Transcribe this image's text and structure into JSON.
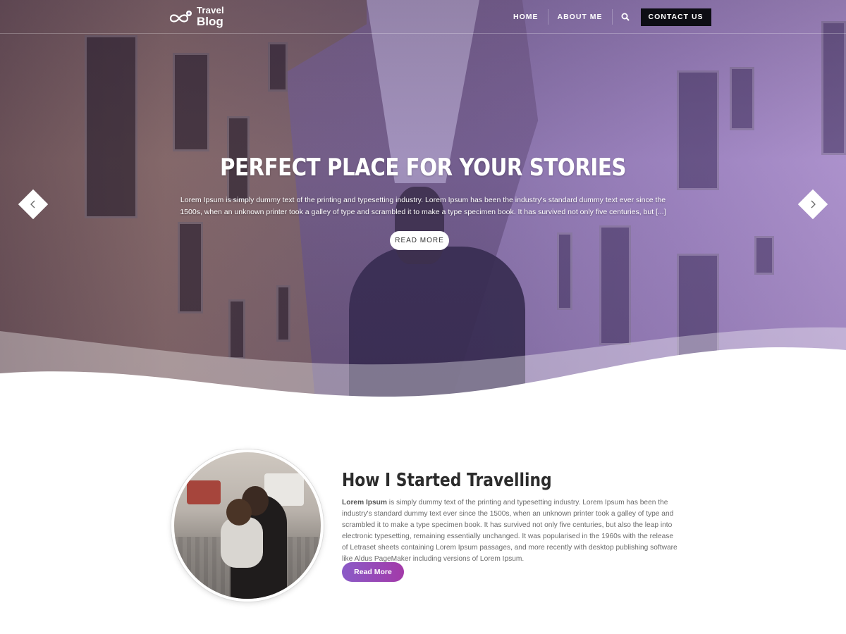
{
  "brand": {
    "logo_line1": "Travel",
    "logo_line2": "Blog",
    "logo_icon": "infinity-pin-icon"
  },
  "nav": {
    "items": [
      {
        "label": "HOME"
      },
      {
        "label": "ABOUT ME"
      }
    ],
    "search_icon": "search-icon",
    "contact_label": "CONTACT US"
  },
  "hero": {
    "title": "PERFECT PLACE FOR YOUR STORIES",
    "description": "Lorem Ipsum is simply dummy text of the printing and typesetting industry. Lorem Ipsum has been the industry's standard dummy text ever since the 1500s, when an unknown printer took a galley of type and scrambled it to make a type specimen book. It has survived not only five centuries, but [...]",
    "button_label": "READ MORE",
    "prev_icon": "chevron-left-icon",
    "next_icon": "chevron-right-icon"
  },
  "feature": {
    "title": "How I Started Travelling",
    "text_lead": "Lorem Ipsum",
    "text_rest": " is simply dummy text of the printing and typesetting industry. Lorem Ipsum has been the industry's standard dummy text ever since the 1500s, when an unknown printer took a galley of type and scrambled it to make a type specimen book. It has survived not only five centuries, but also the leap into electronic typesetting, remaining essentially unchanged. It was popularised in the 1960s with the release of Letraset sheets containing Lorem Ipsum passages, and more recently with desktop publishing software like Aldus PageMaker including versions of Lorem Ipsum.",
    "button_label": "Read More"
  },
  "colors": {
    "accent_gradient_start": "#8a5bc7",
    "accent_gradient_end": "#a33aa9",
    "contact_button": "#0d0d14",
    "hero_overlay": "#8c6ec8"
  }
}
